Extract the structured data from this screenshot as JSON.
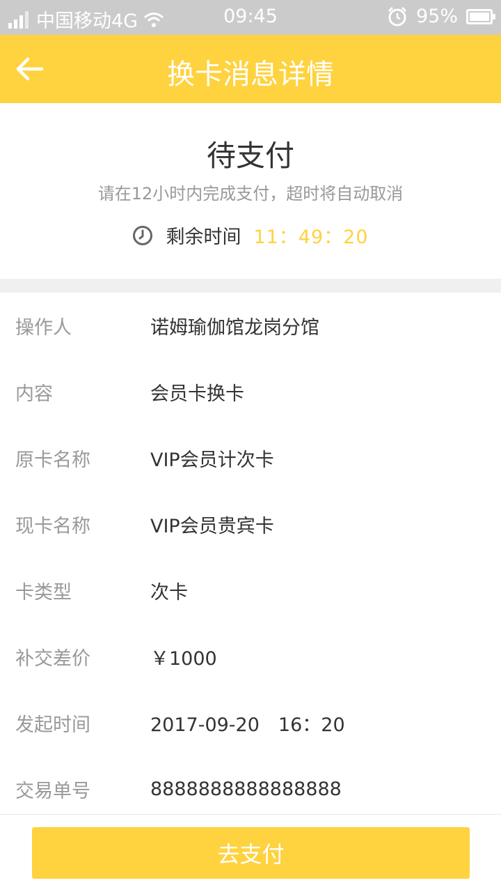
{
  "status_bar": {
    "carrier": "中国移动4G",
    "time": "09:45",
    "battery": "95%"
  },
  "header": {
    "title": "换卡消息详情"
  },
  "status": {
    "title": "待支付",
    "tip": "请在12小时内完成支付，超时将自动取消",
    "countdown_label": "剩余时间",
    "countdown_value": "11：49：20"
  },
  "details": [
    {
      "label": "操作人",
      "value": "诺姆瑜伽馆龙岗分馆"
    },
    {
      "label": "内容",
      "value": "会员卡换卡"
    },
    {
      "label": "原卡名称",
      "value": "VIP会员计次卡"
    },
    {
      "label": "现卡名称",
      "value": "VIP会员贵宾卡"
    },
    {
      "label": "卡类型",
      "value": "次卡"
    },
    {
      "label": "补交差价",
      "value": "￥1000"
    },
    {
      "label": "发起时间",
      "value": "2017-09-20　16：20"
    },
    {
      "label": "交易单号",
      "value": "8888888888888888"
    }
  ],
  "footer": {
    "pay_label": "去支付"
  },
  "colors": {
    "accent": "#ffd23f",
    "status_bar": "#cbcbcb"
  },
  "icons": {
    "back": "arrow-left-icon",
    "clock": "clock-icon",
    "wifi": "wifi-icon",
    "alarm": "alarm-icon",
    "battery": "battery-icon",
    "signal": "signal-icon"
  }
}
